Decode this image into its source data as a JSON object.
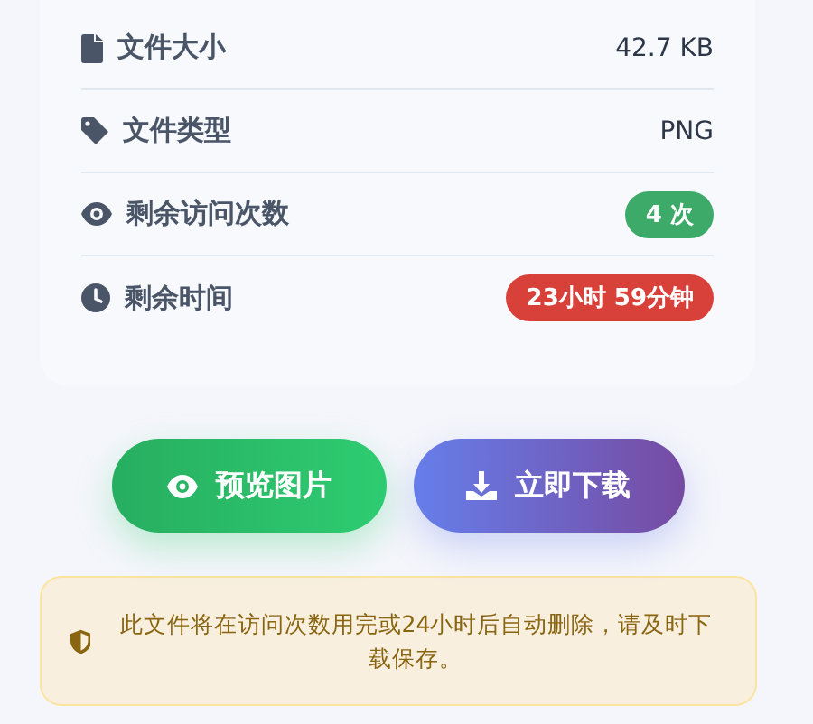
{
  "file_info": [
    {
      "label": "文件大小",
      "kind": "text",
      "value": "42.7 KB"
    },
    {
      "label": "文件类型",
      "kind": "text",
      "value": "PNG"
    },
    {
      "label": "剩余访问次数",
      "kind": "badge",
      "value": "4 次",
      "color": "#3daa6a"
    },
    {
      "label": "剩余时间",
      "kind": "badge",
      "value": "23小时 59分钟",
      "color": "#d8413a"
    }
  ],
  "buttons": [
    {
      "label": "预览图片",
      "kind": "preview"
    },
    {
      "label": "立即下载",
      "kind": "download"
    }
  ],
  "notice": "此文件将在访问次数用完或24小时后自动删除，请及时下载保存。"
}
